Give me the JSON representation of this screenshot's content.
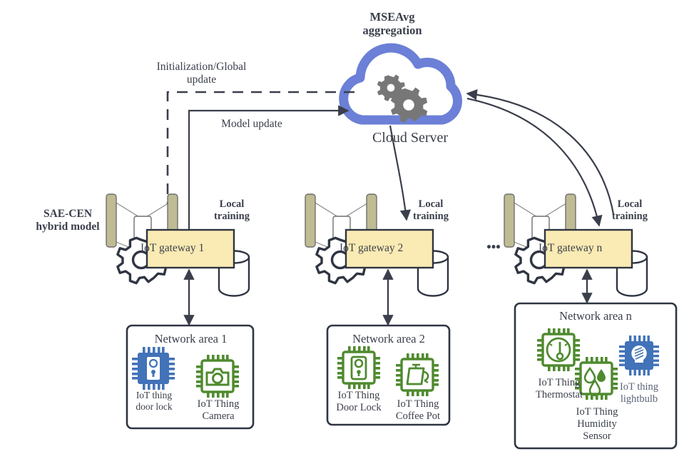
{
  "diagram": {
    "title_top": "MSEAvg\naggregation",
    "cloud_label": "Cloud Server",
    "edge_labels": {
      "init_global": "Initialization/Global\nupdate",
      "model_update": "Model update",
      "local_training": "Local\ntraining"
    },
    "model_label": "SAE-CEN\nhybrid model",
    "ellipsis": "•••",
    "colors": {
      "cloud_blue": "#6b80d6",
      "gear_gray": "#777777",
      "gateway_fill": "#faeab3",
      "gateway_stroke": "#3a3f4b",
      "autoencoder_fill": "#bfbb92",
      "line": "#3a3f4b",
      "iot_green": "#4f8a2f",
      "iot_blue": "#4272b8",
      "text": "#3a3f4b"
    },
    "gateways": [
      {
        "id": "gateway-1",
        "label": "IoT gateway 1",
        "local_training": "Local\ntraining"
      },
      {
        "id": "gateway-2",
        "label": "IoT gateway 2",
        "local_training": "Local\ntraining"
      },
      {
        "id": "gateway-n",
        "label": "IoT gateway n",
        "local_training": "Local\ntraining"
      }
    ],
    "network_areas": [
      {
        "id": "network-area-1",
        "title": "Network area 1",
        "things": [
          {
            "name": "door-lock",
            "label": "IoT thing\ndoor lock",
            "style": "filled-blue",
            "glyph": "lock"
          },
          {
            "name": "camera",
            "label": "IoT Thing\nCamera",
            "style": "outline-green",
            "glyph": "camera"
          }
        ]
      },
      {
        "id": "network-area-2",
        "title": "Network area 2",
        "things": [
          {
            "name": "door-lock",
            "label": "IoT Thing\nDoor Lock",
            "style": "outline-green",
            "glyph": "lock"
          },
          {
            "name": "coffee-pot",
            "label": "IoT Thing\nCoffee Pot",
            "style": "outline-green",
            "glyph": "coffeepot"
          }
        ]
      },
      {
        "id": "network-area-n",
        "title": "Network area n",
        "things": [
          {
            "name": "thermostat",
            "label": "IoT Thing\nThermostat",
            "style": "outline-green",
            "glyph": "thermostat"
          },
          {
            "name": "humidity-sensor",
            "label": "IoT Thing\nHumidity\nSensor",
            "style": "outline-green",
            "glyph": "humidity"
          },
          {
            "name": "lightbulb",
            "label": "IoT thing\nlightbulb",
            "style": "filled-blue",
            "glyph": "lightbulb"
          }
        ]
      }
    ]
  }
}
